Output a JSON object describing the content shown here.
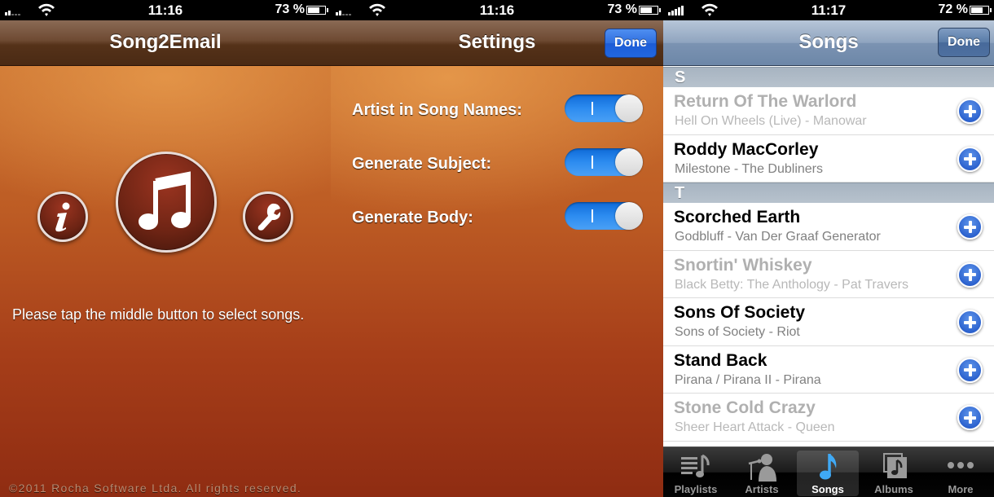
{
  "screens": [
    {
      "status": {
        "time": "11:16",
        "battery": "73 %",
        "battery_level": 0.73
      },
      "nav": {
        "title": "Song2Email"
      },
      "buttons": {
        "info": "info",
        "select_songs": "select songs",
        "settings": "settings"
      },
      "hint": "Please tap the middle button to select songs.",
      "copyright": "©2011 Rocha Software Ltda. All rights reserved."
    },
    {
      "status": {
        "time": "11:16",
        "battery": "73 %",
        "battery_level": 0.73
      },
      "nav": {
        "title": "Settings",
        "done": "Done"
      },
      "settings": [
        {
          "label": "Artist in Song Names:",
          "on": true,
          "on_glyph": "I"
        },
        {
          "label": "Generate Subject:",
          "on": true,
          "on_glyph": "I"
        },
        {
          "label": "Generate Body:",
          "on": true,
          "on_glyph": "I"
        }
      ]
    },
    {
      "status": {
        "time": "11:17",
        "battery": "72 %",
        "battery_level": 0.72
      },
      "nav": {
        "title": "Songs",
        "done": "Done"
      },
      "sections": [
        {
          "letter": "S",
          "songs": [
            {
              "title": "Return Of The Warlord",
              "subtitle": "Hell On Wheels (Live) - Manowar",
              "dimmed": true
            },
            {
              "title": "Roddy MacCorley",
              "subtitle": "Milestone - The Dubliners",
              "dimmed": false
            }
          ]
        },
        {
          "letter": "T",
          "songs": [
            {
              "title": "Scorched Earth",
              "subtitle": "Godbluff - Van Der Graaf Generator",
              "dimmed": false
            },
            {
              "title": "Snortin' Whiskey",
              "subtitle": "Black Betty: The Anthology - Pat Travers",
              "dimmed": true
            },
            {
              "title": "Sons Of Society",
              "subtitle": "Sons of Society - Riot",
              "dimmed": false
            },
            {
              "title": "Stand Back",
              "subtitle": "Pirana / Pirana II - Pirana",
              "dimmed": false
            },
            {
              "title": "Stone Cold Crazy",
              "subtitle": "Sheer Heart Attack - Queen",
              "dimmed": true
            }
          ]
        }
      ],
      "tabs": [
        {
          "label": "Playlists",
          "icon": "playlists-icon",
          "active": false
        },
        {
          "label": "Artists",
          "icon": "artists-icon",
          "active": false
        },
        {
          "label": "Songs",
          "icon": "songs-icon",
          "active": true
        },
        {
          "label": "Albums",
          "icon": "albums-icon",
          "active": false
        },
        {
          "label": "More",
          "icon": "more-icon",
          "active": false
        }
      ]
    }
  ],
  "colors": {
    "toggle_on": "#2d8cf0",
    "done_blue": "#2f6fe0",
    "add_button": "#2d63cf",
    "active_tab_icon": "#3fa9f5"
  }
}
